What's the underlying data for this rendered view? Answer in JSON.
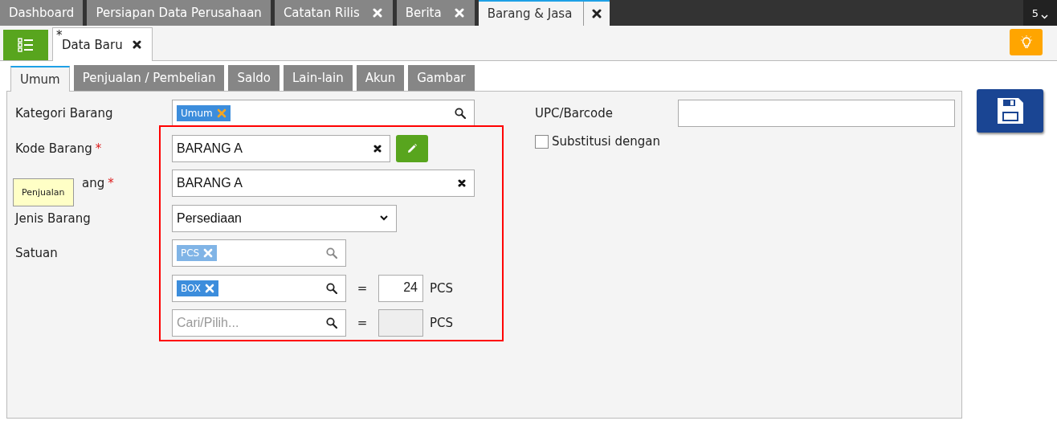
{
  "top_tabs": [
    {
      "label": "Dashboard",
      "closable": false,
      "selected": false
    },
    {
      "label": "Persiapan Data Perusahaan",
      "closable": false,
      "selected": false
    },
    {
      "label": "Catatan Rilis",
      "closable": true,
      "selected": false
    },
    {
      "label": "Berita",
      "closable": true,
      "selected": false
    },
    {
      "label": "Barang & Jasa",
      "closable": true,
      "selected": true
    }
  ],
  "tab_count": "5",
  "doc_tab": {
    "marker": "*",
    "label": "Data Baru",
    "closable": true
  },
  "sub_tabs": [
    {
      "label": "Umum",
      "selected": true
    },
    {
      "label": "Penjualan / Pembelian",
      "selected": false
    },
    {
      "label": "Saldo",
      "selected": false
    },
    {
      "label": "Lain-lain",
      "selected": false
    },
    {
      "label": "Akun",
      "selected": false
    },
    {
      "label": "Gambar",
      "selected": false
    }
  ],
  "form": [
    {
      "kind": "tags",
      "label": "Kategori Barang",
      "tags": [
        {
          "text": "Umum",
          "faded": false
        }
      ]
    },
    {
      "kind": "text",
      "label": "Kode Barang",
      "required": true,
      "value": "BARANG A",
      "clearable": true,
      "editable": true
    },
    {
      "kind": "text",
      "label": "ang",
      "required": true,
      "value": "BARANG A",
      "clearable": true,
      "editable": false
    },
    {
      "kind": "select",
      "label": "Jenis Barang",
      "value": "Persediaan"
    },
    {
      "kind": "unit",
      "label": "Satuan",
      "tags": [
        {
          "text": "PCS",
          "faded": true
        }
      ]
    },
    {
      "kind": "unit",
      "tags": [
        {
          "text": "BOX",
          "faded": false
        }
      ],
      "equals": "=",
      "quantity": "24",
      "unit": "PCS"
    },
    {
      "kind": "unit",
      "placeholder": "Cari/Pilih...",
      "equals": "=",
      "unit": "PCS"
    }
  ],
  "right_form": {
    "barcode_label": "UPC/Barcode",
    "substitute": {
      "label": "Substitusi dengan",
      "checked": false
    }
  },
  "tooltip": {
    "text": "Penjualan"
  }
}
